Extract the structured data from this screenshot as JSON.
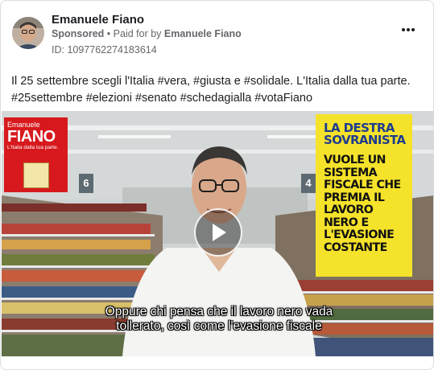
{
  "post": {
    "page_name": "Emanuele Fiano",
    "sponsored_label": "Sponsored",
    "separator": "•",
    "paid_for_prefix": "Paid for by",
    "paid_for_name": "Emanuele Fiano",
    "ad_id": "ID: 1097762274183614",
    "more_icon": "more-horizontal-icon",
    "body_line1": "Il 25 settembre scegli l'Italia #vera, #giusta e #solidale. L'Italia dalla tua parte.",
    "body_line2": "#25settembre #elezioni #senato #schedagialla #votaFiano"
  },
  "video": {
    "brand_first": "Emanuele",
    "brand_last": "FIANO",
    "brand_slogan": "L'Italia dalla tua parte.",
    "aisle_left": "6",
    "aisle_right": "4",
    "panel_headline": "LA DESTRA SOVRANISTA",
    "panel_body": "VUOLE UN SISTEMA FISCALE CHE PREMIA IL LAVORO NERO E L'EVASIONE COSTANTE",
    "subtitle_line1": "Oppure chi pensa che il lavoro nero vada",
    "subtitle_line2": "tollerato, così come l'evasione fiscale",
    "play_icon": "play-icon",
    "panel_color": "#f5e22a",
    "brand_color": "#d7191d"
  }
}
